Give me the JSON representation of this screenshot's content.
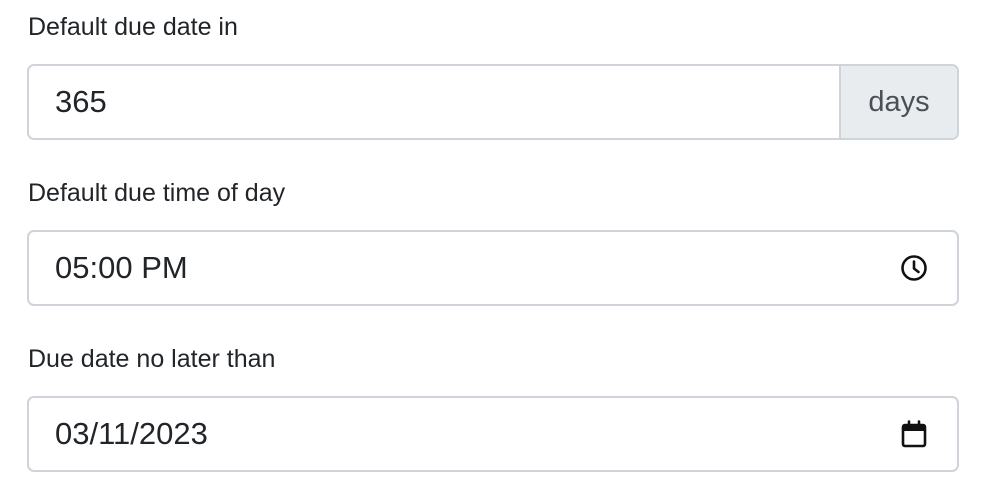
{
  "due_in": {
    "label": "Default due date in",
    "value": "365",
    "unit": "days"
  },
  "due_time": {
    "label": "Default due time of day",
    "value": "05:00 PM",
    "icon": "clock-icon"
  },
  "due_no_later": {
    "label": "Due date no later than",
    "value": "03/11/2023",
    "icon": "calendar-icon"
  }
}
